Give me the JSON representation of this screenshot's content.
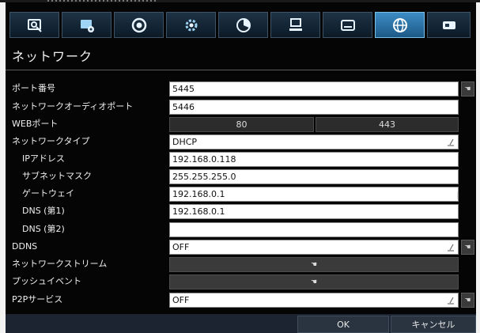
{
  "toolbar": {
    "buttons": [
      {
        "icon": "camera-search-icon",
        "active": false
      },
      {
        "icon": "display-settings-icon",
        "active": false
      },
      {
        "icon": "record-icon",
        "active": false
      },
      {
        "icon": "gear-icon",
        "active": false
      },
      {
        "icon": "pie-chart-icon",
        "active": false
      },
      {
        "icon": "computer-icon",
        "active": false
      },
      {
        "icon": "keyboard-icon",
        "active": false
      },
      {
        "icon": "globe-icon",
        "active": true
      },
      {
        "icon": "storage-icon",
        "active": false
      }
    ]
  },
  "page": {
    "title": "ネットワーク"
  },
  "form": {
    "port": {
      "label": "ポート番号",
      "value": "5445"
    },
    "audio_port": {
      "label": "ネットワークオーディオポート",
      "value": "5446"
    },
    "web_port": {
      "label": "WEBポート",
      "value_http": "80",
      "value_https": "443"
    },
    "network_type": {
      "label": "ネットワークタイプ",
      "value": "DHCP"
    },
    "ip": {
      "label": "IPアドレス",
      "value": "192.168.0.118"
    },
    "subnet": {
      "label": "サブネットマスク",
      "value": "255.255.255.0"
    },
    "gateway": {
      "label": "ゲートウェイ",
      "value": "192.168.0.1"
    },
    "dns1": {
      "label": "DNS (第1)",
      "value": "192.168.0.1"
    },
    "dns2": {
      "label": "DNS (第2)",
      "value": ""
    },
    "ddns": {
      "label": "DDNS",
      "value": "OFF"
    },
    "stream": {
      "label": "ネットワークストリーム"
    },
    "push": {
      "label": "プッシュイベント"
    },
    "p2p": {
      "label": "P2Pサービス",
      "value": "OFF"
    }
  },
  "footer": {
    "ok_label": "OK",
    "cancel_label": "キャンセル"
  },
  "colors": {
    "accent": "#3d8cc4",
    "panel": "#050505",
    "footer": "#1b2430"
  }
}
